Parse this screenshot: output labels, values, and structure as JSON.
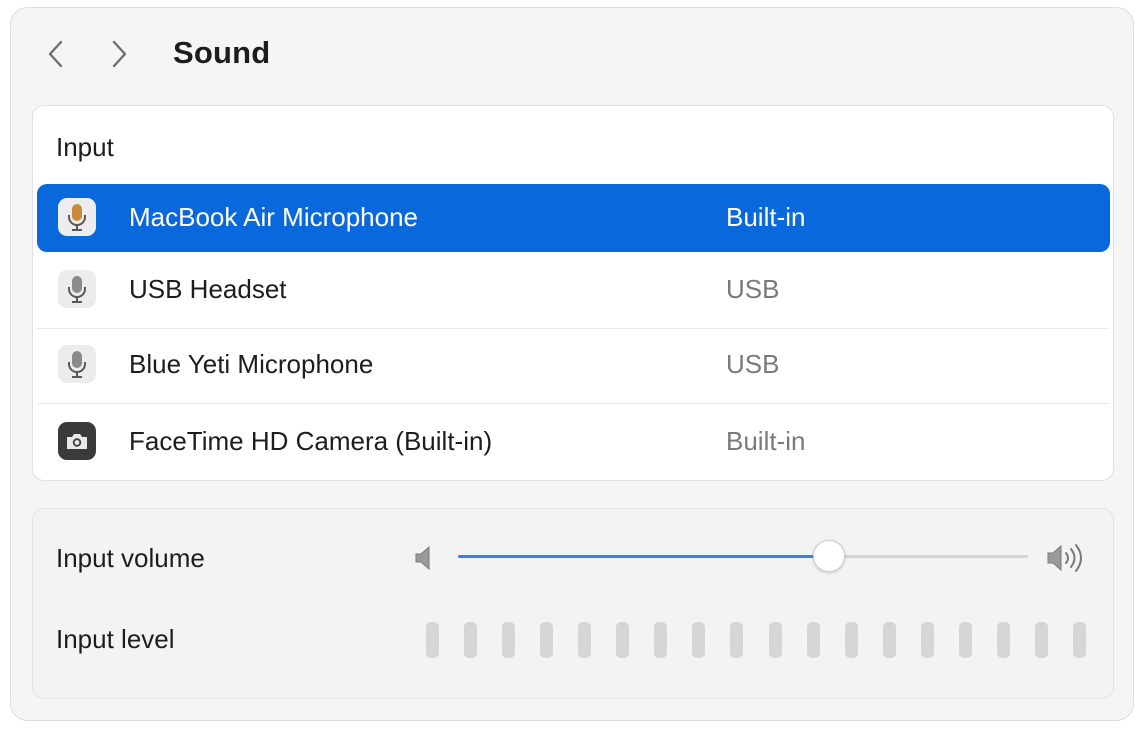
{
  "header": {
    "title": "Sound",
    "back_icon": "chevron-left-icon",
    "forward_icon": "chevron-right-icon"
  },
  "input_section": {
    "heading": "Input",
    "selected_index": 0,
    "devices": [
      {
        "name": "MacBook Air Microphone",
        "type": "Built-in",
        "icon": "microphone-icon"
      },
      {
        "name": "USB Headset",
        "type": "USB",
        "icon": "microphone-icon"
      },
      {
        "name": "Blue Yeti Microphone",
        "type": "USB",
        "icon": "microphone-icon"
      },
      {
        "name": "FaceTime HD Camera (Built-in)",
        "type": "Built-in",
        "icon": "camera-icon"
      }
    ]
  },
  "volume_section": {
    "input_volume_label": "Input volume",
    "input_volume_fraction": 0.65,
    "input_level_label": "Input level",
    "input_level_segments": 18,
    "input_level_active": 0
  },
  "colors": {
    "accent": "#0a68dd",
    "slider_fill": "#3f7fe0",
    "window_bg": "#f5f5f5",
    "level_inactive": "#d6d6d6"
  }
}
